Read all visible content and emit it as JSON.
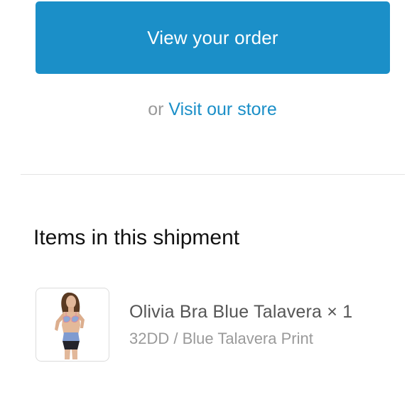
{
  "actions": {
    "view_order_label": "View your order",
    "or_text": "or",
    "visit_store_label": "Visit our store"
  },
  "shipment": {
    "title": "Items in this shipment",
    "items": [
      {
        "title": "Olivia Bra Blue Talavera × 1",
        "variant": "32DD / Blue Talavera Print",
        "thumbnail": "product-photo"
      }
    ]
  },
  "colors": {
    "accent": "#1b8fc8",
    "muted_text": "#9a9a9a",
    "item_title": "#555555",
    "heading": "#111111",
    "divider": "#e4e4e4"
  }
}
